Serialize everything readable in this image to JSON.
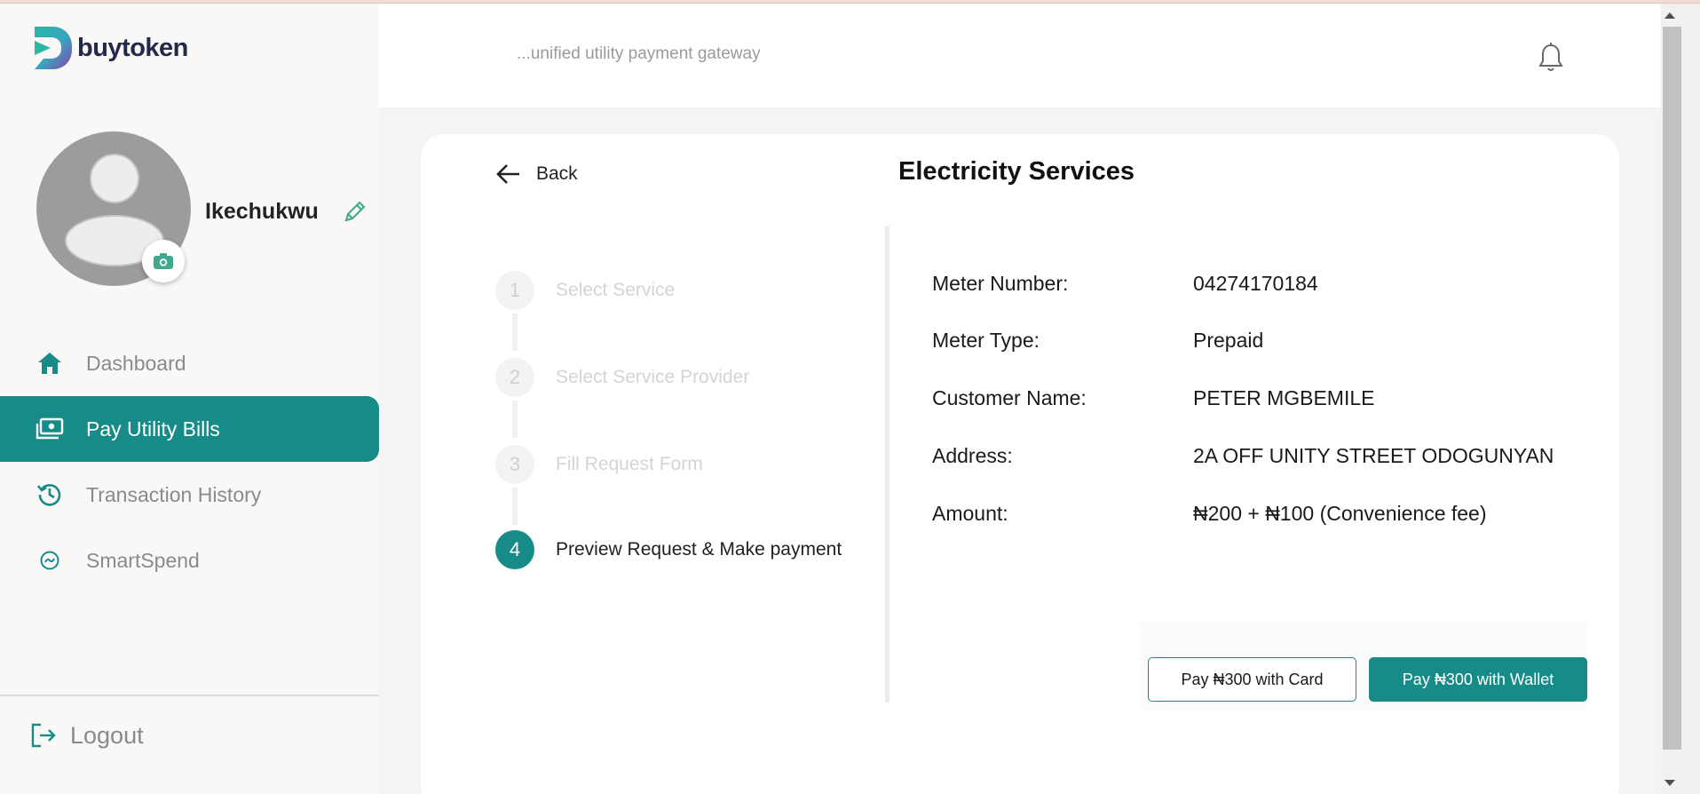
{
  "brand": {
    "name": "buytoken",
    "tagline": "...unified utility payment gateway",
    "accent": "#178b87"
  },
  "user": {
    "name": "Ikechukwu"
  },
  "sidebar": {
    "items": [
      {
        "label": "Dashboard",
        "icon": "home-icon"
      },
      {
        "label": "Pay Utility Bills",
        "icon": "wallet-bills-icon",
        "active": true
      },
      {
        "label": "Transaction History",
        "icon": "history-icon"
      },
      {
        "label": "SmartSpend",
        "icon": "smartspend-icon"
      }
    ],
    "logout": "Logout"
  },
  "page": {
    "back": "Back",
    "title": "Electricity Services"
  },
  "steps": [
    {
      "number": "1",
      "label": "Select Service"
    },
    {
      "number": "2",
      "label": "Select Service Provider"
    },
    {
      "number": "3",
      "label": "Fill Request Form"
    },
    {
      "number": "4",
      "label": "Preview Request & Make payment",
      "active": true
    }
  ],
  "details": [
    {
      "label": "Meter Number:",
      "value": "04274170184"
    },
    {
      "label": "Meter Type:",
      "value": "Prepaid"
    },
    {
      "label": "Customer Name:",
      "value": "PETER MGBEMILE"
    },
    {
      "label": "Address:",
      "value": "2A OFF UNITY STREET ODOGUNYAN"
    },
    {
      "label": "Amount:",
      "value": "₦200 + ₦100 (Convenience fee)"
    }
  ],
  "actions": {
    "pay_card": "Pay ₦300 with Card",
    "pay_wallet": "Pay ₦300 with Wallet"
  }
}
